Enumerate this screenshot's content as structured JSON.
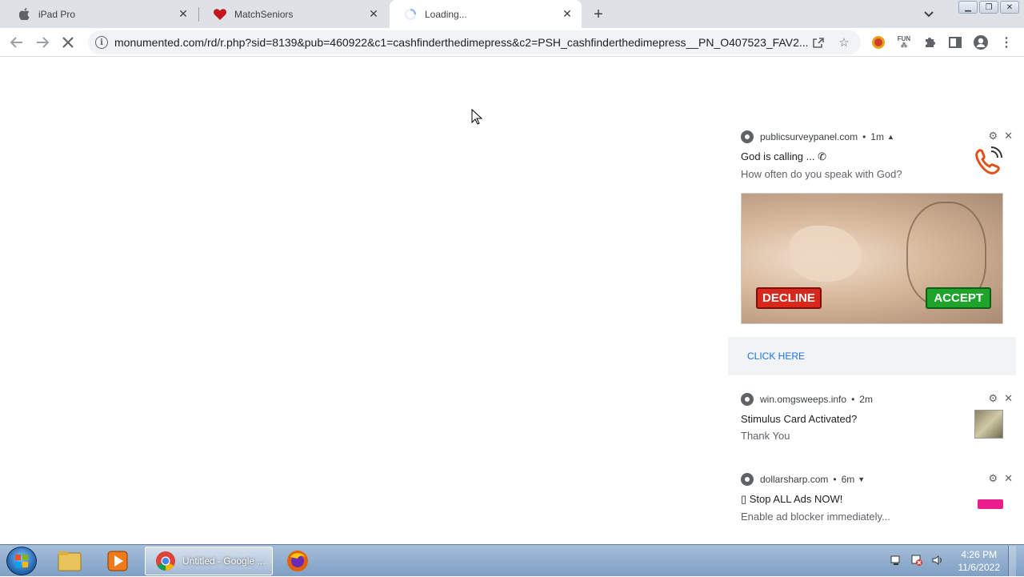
{
  "browser": {
    "tabs": [
      {
        "title": "iPad Pro",
        "icon": "apple-icon"
      },
      {
        "title": "MatchSeniors",
        "icon": "heart-icon"
      },
      {
        "title": "Loading...",
        "icon": "loading-spinner-icon",
        "active": true
      }
    ],
    "url": "monumented.com/rd/r.php?sid=8139&pub=460922&c1=cashfinderthedimepress&c2=PSH_cashfinderthedimepress__PN_O407523_FAV2..."
  },
  "notifications": [
    {
      "site": "publicsurveypanel.com",
      "time": "1m",
      "title": "God is calling ...",
      "body": "How often do you speak with God?",
      "image_buttons": {
        "decline": "DECLINE",
        "accept": "ACCEPT"
      },
      "action": "CLICK HERE"
    },
    {
      "site": "win.omgsweeps.info",
      "time": "2m",
      "title": "Stimulus Card Activated?",
      "body": "Thank You"
    },
    {
      "site": "dollarsharp.com",
      "time": "6m",
      "title": "▯ Stop ALL Ads NOW!",
      "body": "Enable ad blocker immediately..."
    }
  ],
  "taskbar": {
    "active_window": "Untitled - Google ...",
    "clock_time": "4:26 PM",
    "clock_date": "11/6/2022"
  },
  "colors": {
    "tab_strip": "#dee1e6",
    "link_blue": "#1a73e8",
    "decline_red": "#d9271c",
    "accept_green": "#1ea32b"
  }
}
